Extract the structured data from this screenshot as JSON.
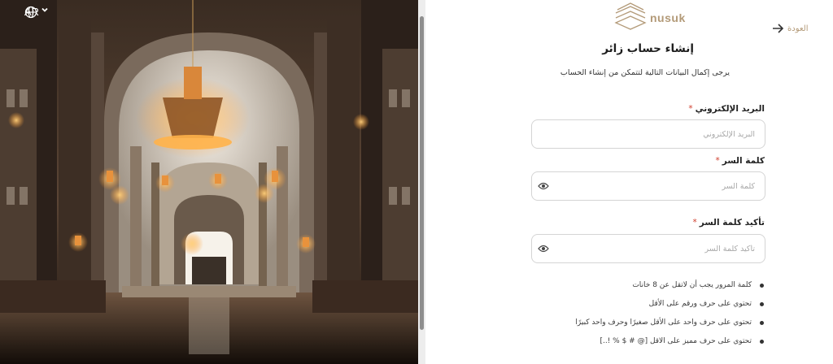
{
  "language": {
    "label": "AR",
    "icon": "globe-icon"
  },
  "logo": {
    "text": "nusuk"
  },
  "back": {
    "label": "العودة",
    "icon": "arrow-right-icon"
  },
  "form": {
    "title": "إنشاء حساب زائر",
    "subtitle": "يرجى إكمال البيانات التالية لتتمكن من إنشاء الحساب",
    "required_mark": "*",
    "email": {
      "label": "البريد الإلكتروني",
      "placeholder": "البريد الإلكتروني",
      "value": ""
    },
    "password": {
      "label": "كلمة السر",
      "placeholder": "كلمة السر",
      "value": ""
    },
    "confirm_password": {
      "label": "تأكيد كلمة السر",
      "placeholder": "تأكيد كلمة السر",
      "value": ""
    }
  },
  "password_rules": [
    "كلمة المرور يجب أن لاتقل عن 8 خانات",
    "تحتوي على حرف ورقم على الأقل",
    "تحتوي على حرف واحد على الأقل صغيرًا وحرف واحد كبيرًا",
    "تحتوي على حرف مميز على الاقل [@ # $ % !..]"
  ],
  "colors": {
    "brand": "#b39a78",
    "required": "#d0402f",
    "border": "#d4d4d4"
  }
}
